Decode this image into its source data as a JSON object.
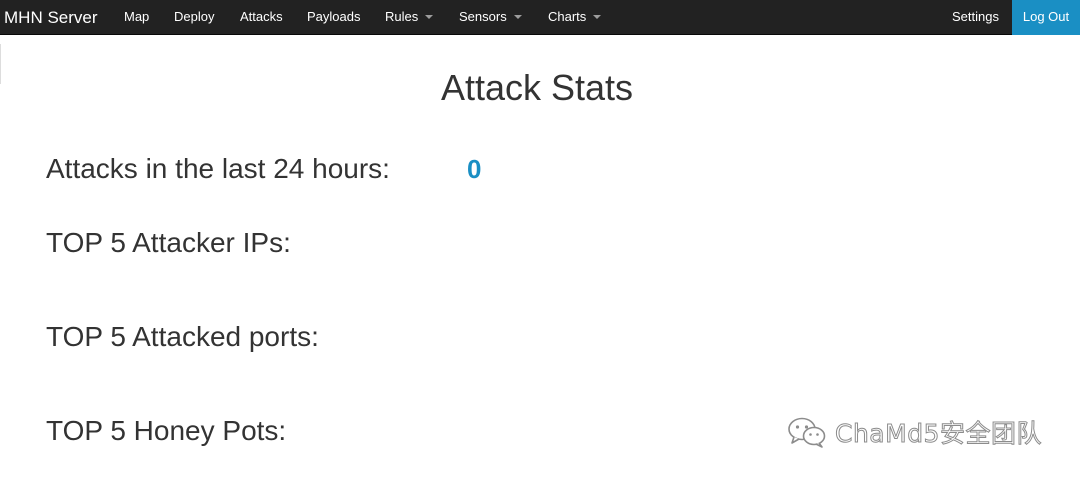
{
  "navbar": {
    "brand": "MHN Server",
    "items": [
      {
        "label": "Map"
      },
      {
        "label": "Deploy"
      },
      {
        "label": "Attacks"
      },
      {
        "label": "Payloads"
      },
      {
        "label": "Rules"
      },
      {
        "label": "Sensors"
      },
      {
        "label": "Charts"
      }
    ],
    "settings_label": "Settings",
    "logout_label": "Log Out",
    "colors": {
      "background": "#222222",
      "logout_background": "#1a8fc4"
    }
  },
  "main": {
    "title": "Attack Stats",
    "attacks_24h_label": "Attacks in the last 24 hours:",
    "attacks_24h_value": "0",
    "top_ips_label": "TOP 5 Attacker IPs:",
    "top_ports_label": "TOP 5 Attacked ports:",
    "top_honeypots_label": "TOP 5 Honey Pots:",
    "accent_color": "#1a8fc4"
  },
  "watermark": {
    "icon": "wechat-icon",
    "text": "ChaMd5安全团队"
  }
}
